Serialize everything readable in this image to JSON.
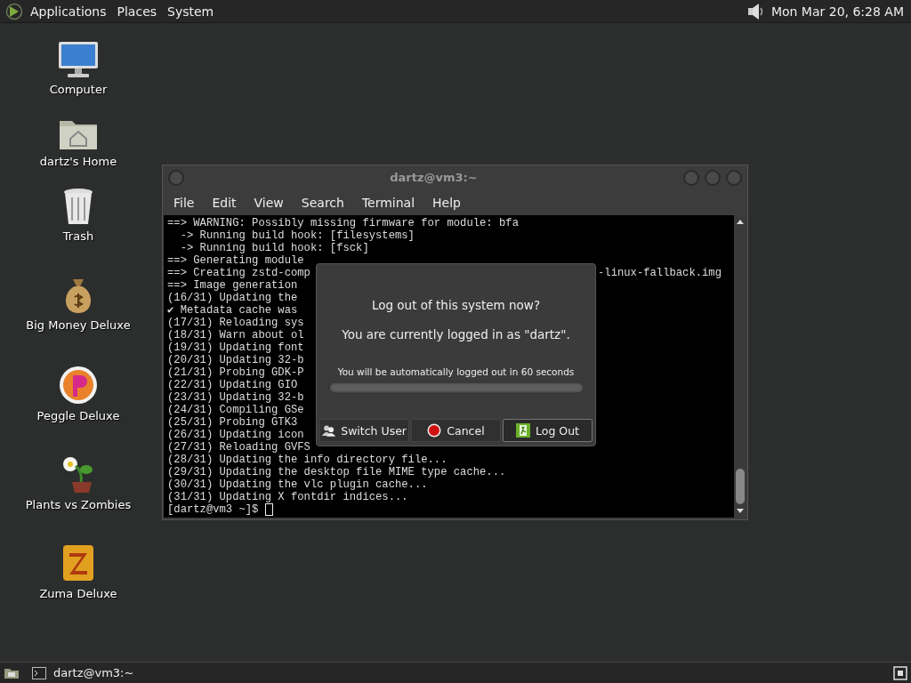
{
  "top_panel": {
    "menus": [
      "Applications",
      "Places",
      "System"
    ],
    "clock": "Mon Mar 20,  6:28 AM"
  },
  "desktop_icons": [
    {
      "kind": "computer",
      "label": "Computer"
    },
    {
      "kind": "home",
      "label": "dartz's Home"
    },
    {
      "kind": "trash",
      "label": "Trash"
    },
    {
      "kind": "money",
      "label": "Big Money Deluxe"
    },
    {
      "kind": "peggle",
      "label": "Peggle Deluxe"
    },
    {
      "kind": "plants",
      "label": "Plants vs Zombies"
    },
    {
      "kind": "zuma",
      "label": "Zuma Deluxe"
    }
  ],
  "terminal": {
    "title": "dartz@vm3:~",
    "menu": [
      "File",
      "Edit",
      "View",
      "Search",
      "Terminal",
      "Help"
    ],
    "lines": [
      {
        "text": "==> WARNING: Possibly missing firmware for module: bfa"
      },
      {
        "text": "  -> Running build hook: [filesystems]"
      },
      {
        "text": "  -> Running build hook: [fsck]"
      },
      {
        "text": "==> Generating module"
      },
      {
        "text": "==> Creating zstd-comp",
        "right": "-linux-fallback.img"
      },
      {
        "text": "==> Image generation"
      },
      {
        "text": "(16/31) Updating the"
      },
      {
        "text": "✔ Metadata cache was"
      },
      {
        "text": "(17/31) Reloading sys"
      },
      {
        "text": "(18/31) Warn about ol"
      },
      {
        "text": "(19/31) Updating font"
      },
      {
        "text": "(20/31) Updating 32-b"
      },
      {
        "text": "(21/31) Probing GDK-P"
      },
      {
        "text": "(22/31) Updating GIO"
      },
      {
        "text": "(23/31) Updating 32-b"
      },
      {
        "text": "(24/31) Compiling GSe"
      },
      {
        "text": "(25/31) Probing GTK3"
      },
      {
        "text": "(26/31) Updating icon"
      },
      {
        "text": "(27/31) Reloading GVFS"
      },
      {
        "text": "(28/31) Updating the info directory file..."
      },
      {
        "text": "(29/31) Updating the desktop file MIME type cache..."
      },
      {
        "text": "(30/31) Updating the vlc plugin cache..."
      },
      {
        "text": "(31/31) Updating X fontdir indices..."
      }
    ],
    "prompt": "[dartz@vm3 ~]$"
  },
  "logout_dialog": {
    "question": "Log out of this system now?",
    "info": "You are currently logged in as \"dartz\".",
    "countdown": "You will be automatically logged out in 60 seconds",
    "level": 1,
    "buttons": [
      {
        "kind": "switch",
        "label": "Switch User",
        "selected": false
      },
      {
        "kind": "cancel",
        "label": "Cancel",
        "selected": false
      },
      {
        "kind": "logout",
        "label": "Log Out",
        "selected": true
      }
    ]
  },
  "bottom_panel": {
    "tasks": [
      "dartz@vm3:~"
    ]
  }
}
